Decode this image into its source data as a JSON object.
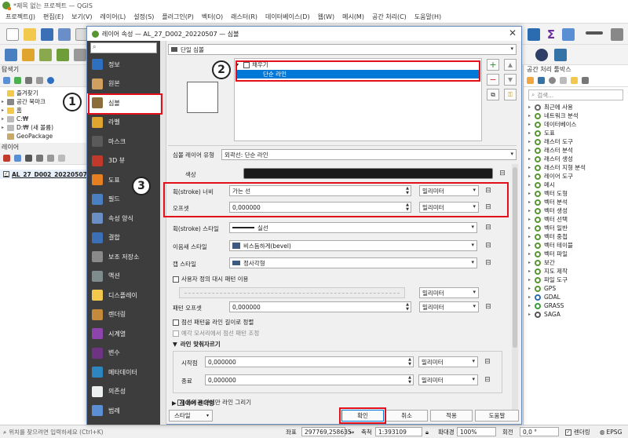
{
  "window": {
    "title": "*제목 없는 프로젝트 — QGIS"
  },
  "menu": [
    "프로젝트(J)",
    "편집(E)",
    "보기(V)",
    "레이어(L)",
    "설정(S)",
    "플러그인(P)",
    "벡터(O)",
    "래스터(R)",
    "데이터베이스(D)",
    "웹(W)",
    "메시(M)",
    "공간 처리(C)",
    "도움말(H)"
  ],
  "browser": {
    "title": "탐색기",
    "items": [
      {
        "label": "즐겨찾기",
        "expand": ""
      },
      {
        "label": "공간 북마크",
        "expand": "▸"
      },
      {
        "label": "홈",
        "expand": "▸"
      },
      {
        "label": "C:₩",
        "expand": "▸"
      },
      {
        "label": "D:₩ (새 볼륨)",
        "expand": "▸"
      },
      {
        "label": "GeoPackage",
        "expand": ""
      }
    ]
  },
  "layers": {
    "title": "레이어",
    "row": "AL_27_D002_20220507"
  },
  "toolbox": {
    "title": "공간 처리 툴박스",
    "search_placeholder": "검색...",
    "items": [
      "최근에 사용",
      "네트워크 분석",
      "데이터베이스",
      "도표",
      "래스터 도구",
      "래스터 분석",
      "래스터 생성",
      "래스터 지형 분석",
      "레이어 도구",
      "메시",
      "벡터 도형",
      "벡터 분석",
      "벡터 생성",
      "벡터 선택",
      "벡터 일반",
      "벡터 중첩",
      "벡터 테이블",
      "벡터 파일",
      "보간",
      "지도 제작",
      "파일 도구",
      "GPS",
      "GDAL",
      "GRASS",
      "SAGA"
    ]
  },
  "status": {
    "locator_placeholder": "위치를 찾으려면 입력하세요 (Ctrl+K)",
    "coord_label": "좌표",
    "coord_value": "297769,258635",
    "scale_label": "축척",
    "scale_value": "1:393109",
    "magnifier_label": "확대경",
    "magnifier_value": "100%",
    "rotation_label": "회전",
    "rotation_value": "0,0 °",
    "render_label": "렌더링",
    "crs": "EPSG"
  },
  "dialog": {
    "title": "레이어 속성 — AL_27_D002_20220507 — 심볼",
    "nav": [
      "정보",
      "원본",
      "심볼",
      "라벨",
      "마스크",
      "3D 뷰",
      "도표",
      "필드",
      "속성 양식",
      "결합",
      "보조 저장소",
      "액션",
      "디스플레이",
      "렌더링",
      "시계열",
      "변수",
      "메타데이터",
      "의존성",
      "범례",
      "QGIS 서버"
    ],
    "renderer": "단일 심볼",
    "tree_fill": "채우기",
    "tree_line": "단순 라인",
    "layer_type_label": "심볼 레이어 유형",
    "layer_type_value": "외곽선: 단순 라인",
    "color_label": "색상",
    "stroke_width_label": "획(stroke) 너비",
    "stroke_width_value": "가는 선",
    "offset_label": "오프셋",
    "offset_value": "0,000000",
    "unit_mm": "밀리미터",
    "stroke_style_label": "획(stroke) 스타일",
    "stroke_style_value": "실선",
    "join_style_label": "이음새 스타일",
    "join_style_value": "비스듬하게(bevel)",
    "cap_style_label": "캡 스타일",
    "cap_style_value": "정사각형",
    "custom_dash_label": "사용자 정의 대시 패턴 이용",
    "pattern_offset_label": "패턴 오프셋",
    "pattern_offset_value": "0,000000",
    "align_dash_label": "점선 패턴을 라인 길이로 정렬",
    "tweak_dash_label": "예각 모서리에서 점선 패턴 조정",
    "trim_section": "라인 맞춰자르기",
    "start_label": "시작점",
    "start_value": "0,000000",
    "end_label": "종료",
    "end_value": "0,000000",
    "draw_inside_label": "폴리곤 안에만 라인 그리기",
    "layer_render_section": "레이어 렌더링",
    "style_button": "스타일",
    "ok_button": "확인",
    "cancel_button": "취소",
    "apply_button": "적용",
    "help_button": "도움말"
  },
  "callouts": [
    "1",
    "2",
    "3"
  ],
  "colors": {
    "accent": "#0078d7",
    "highlight": "#e3101c",
    "sidebar": "#3d3d3d",
    "qgis_green": "#589632"
  }
}
